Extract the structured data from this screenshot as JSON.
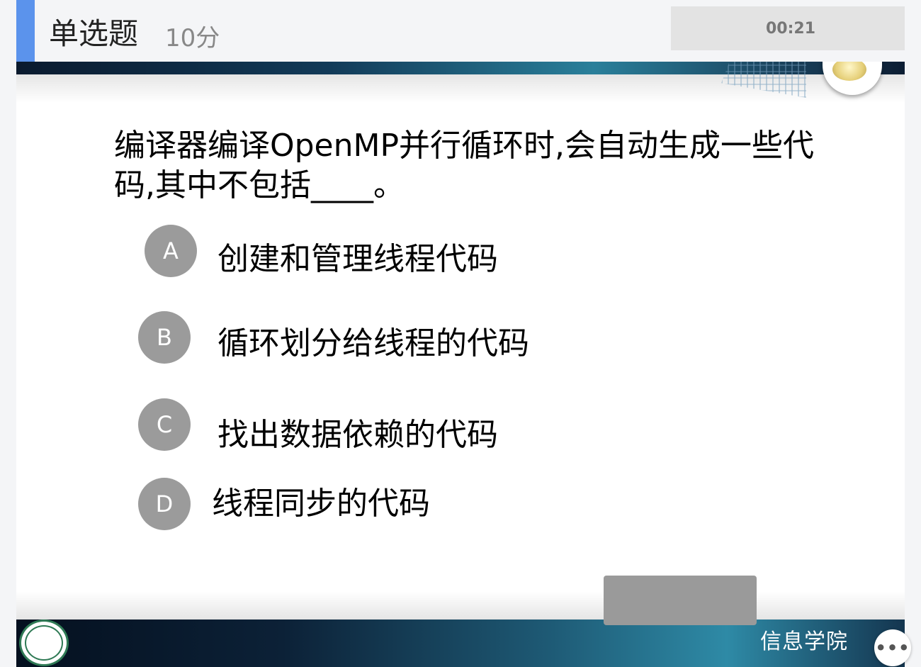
{
  "header": {
    "question_type": "单选题",
    "score": "10分",
    "timer_label": "",
    "timer_value": "00:21"
  },
  "question": {
    "text": "编译器编译OpenMP并行循环时,会自动生成一些代码,其中不包括____。"
  },
  "options": [
    {
      "letter": "A",
      "text": "创建和管理线程代码"
    },
    {
      "letter": "B",
      "text": "循环划分给线程的代码"
    },
    {
      "letter": "C",
      "text": "找出数据依赖的代码"
    },
    {
      "letter": "D",
      "text": "线程同步的代码"
    }
  ],
  "submit_label": "",
  "footer": {
    "college": "信息学院"
  },
  "more_button": "•••",
  "colors": {
    "accent": "#5b93ec",
    "badge": "#9b9b9b",
    "submit": "#9a9a9a"
  }
}
